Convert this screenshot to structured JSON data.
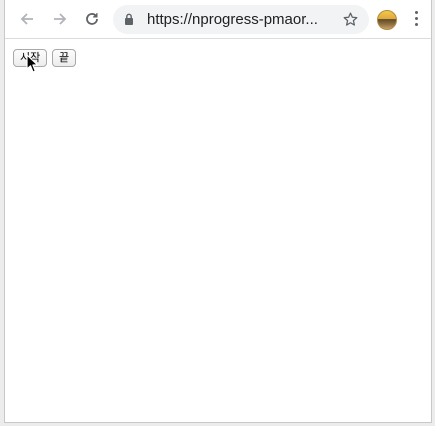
{
  "browser": {
    "url": "https://nprogress-pmaor...",
    "back_icon": "arrow-left-icon",
    "forward_icon": "arrow-right-icon",
    "reload_icon": "reload-icon",
    "lock_icon": "lock-icon",
    "bookmark_icon": "star-icon",
    "profile_icon": "avatar",
    "menu_icon": "kebab-menu-icon",
    "colors": {
      "toolbar": "#ffffff",
      "omnibox": "#f1f3f4",
      "icon": "#5f6368"
    }
  },
  "page": {
    "start_button": "시작",
    "end_button": "끝"
  }
}
